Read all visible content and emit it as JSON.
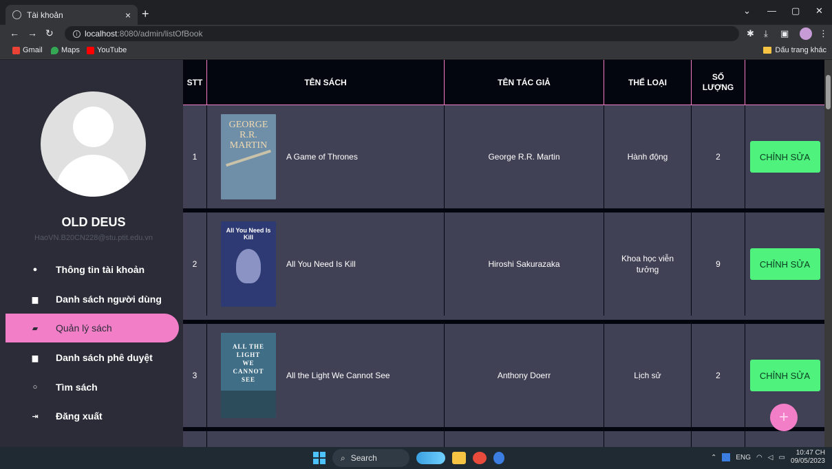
{
  "browser": {
    "tab_title": "Tài khoản",
    "tab_close": "×",
    "new_tab": "+",
    "url_host": "localhost",
    "url_path": ":8080/admin/listOfBook",
    "bookmarks": [
      {
        "label": "Gmail",
        "color": "#ea4335"
      },
      {
        "label": "Maps",
        "color": "#34a853"
      },
      {
        "label": "YouTube",
        "color": "#ff0000"
      }
    ],
    "other_bookmarks": "Dấu trang khác"
  },
  "sidebar": {
    "username": "OLD DEUS",
    "email": "HaoVN.B20CN228@stu.ptit.edu.vn",
    "items": [
      {
        "label": "Thông tin tài khoản",
        "icon": "user-icon"
      },
      {
        "label": "Danh sách người dùng",
        "icon": "address-book-icon"
      },
      {
        "label": "Quản lý sách",
        "icon": "book-open-icon",
        "active": true
      },
      {
        "label": "Danh sách phê duyệt",
        "icon": "book-icon"
      },
      {
        "label": "Tìm sách",
        "icon": "search-icon"
      },
      {
        "label": "Đăng xuất",
        "icon": "sign-out-icon"
      }
    ]
  },
  "table": {
    "headers": {
      "stt": "STT",
      "title": "TÊN SÁCH",
      "author": "TÊN TÁC GIẢ",
      "genre": "THỂ LOẠI",
      "qty_1": "SỐ",
      "qty_2": "LƯỢNG"
    },
    "rows": [
      {
        "stt": "1",
        "title": "A Game of Thrones",
        "author": "George R.R. Martin",
        "genre": "Hành động",
        "qty": "2",
        "action": "CHỈNH SỬA",
        "cover_text": "GEORGE R.R. MARTIN",
        "cover_color": "#6f8fa8"
      },
      {
        "stt": "2",
        "title": "All You Need Is Kill",
        "author": "Hiroshi Sakurazaka",
        "genre": "Khoa học viễn tưởng",
        "qty": "9",
        "action": "CHỈNH SỬA",
        "cover_text": "All You Need Is Kill",
        "cover_color": "#2e3a73"
      },
      {
        "stt": "3",
        "title": "All the Light We Cannot See",
        "author": "Anthony Doerr",
        "genre": "Lịch sử",
        "qty": "2",
        "action": "CHỈNH SỬA",
        "cover_text": "ALL THE LIGHT WE CANNOT SEE",
        "cover_color": "#3f6e86"
      }
    ]
  },
  "fab_label": "+",
  "taskbar": {
    "search": "Search",
    "lang": "ENG",
    "time": "10:47 CH",
    "date": "09/05/2023"
  },
  "colors": {
    "accent": "#f27ec8",
    "button": "#4ef27d",
    "sidebar": "#2b2c37",
    "table_bg": "#414155"
  }
}
